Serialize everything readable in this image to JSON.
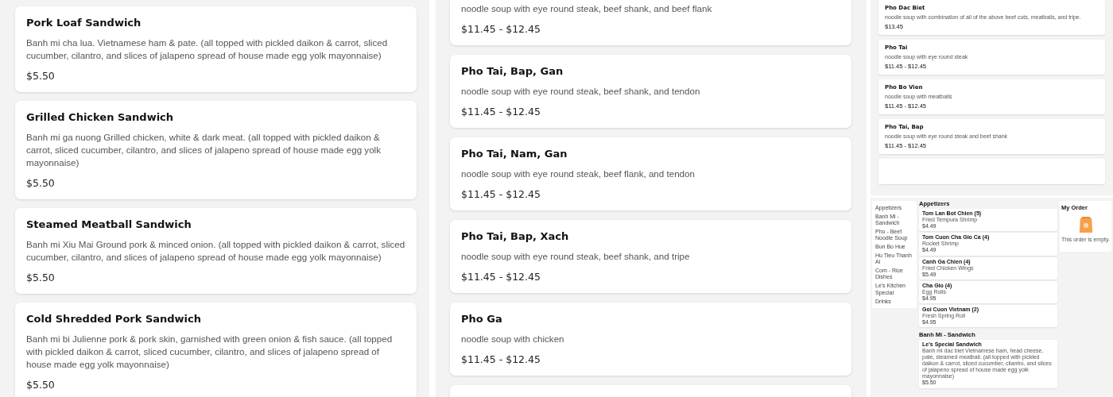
{
  "left_panel": {
    "items": [
      {
        "name": "Pork Loaf Sandwich",
        "description": "Banh mi cha lua. Vietnamese ham & pate. (all topped with pickled daikon & carrot, sliced cucumber, cilantro, and slices of jalapeno spread of house made egg yolk mayonnaise)",
        "price": "$5.50"
      },
      {
        "name": "Grilled Chicken Sandwich",
        "description": "Banh mi ga nuong Grilled chicken, white & dark meat. (all topped with pickled daikon & carrot, sliced cucumber, cilantro, and slices of jalapeno spread of house made egg yolk mayonnaise)",
        "price": "$5.50"
      },
      {
        "name": "Steamed Meatball Sandwich",
        "description": "Banh mi Xiu Mai Ground pork & minced onion. (all topped with pickled daikon & carrot, sliced cucumber, cilantro, and slices of jalapeno spread of house made egg yolk mayonnaise)",
        "price": "$5.50"
      },
      {
        "name": "Cold Shredded Pork Sandwich",
        "description": "Banh mi bi Julienne pork & pork skin, garnished with green onion & fish sauce. (all topped with pickled daikon & carrot, sliced cucumber, cilantro, and slices of jalapeno spread of house made egg yolk mayonnaise)",
        "price": "$5.50"
      }
    ]
  },
  "middle_panel": {
    "items": [
      {
        "description": "noodle soup with eye round steak, beef shank, and beef flank",
        "price": "$11.45 - $12.45"
      },
      {
        "name": "Pho Tai, Bap, Gan",
        "description": "noodle soup with eye round steak, beef shank, and tendon",
        "price": "$11.45 - $12.45"
      },
      {
        "name": "Pho Tai, Nam, Gan",
        "description": "noodle soup with eye round steak, beef flank, and tendon",
        "price": "$11.45 - $12.45"
      },
      {
        "name": "Pho Tai, Bap, Xach",
        "description": "noodle soup with eye round steak, beef shank, and tripe",
        "price": "$11.45 - $12.45"
      },
      {
        "name": "Pho Ga",
        "description": "noodle soup with chicken",
        "price": "$11.45 - $12.45"
      }
    ]
  },
  "right_top_panel": {
    "items": [
      {
        "name": "Pho Dac Biet",
        "description": "noodle soup with combination of all of the above beef cuts, meatballs, and tripe.",
        "price": "$13.45"
      },
      {
        "name": "Pho Tai",
        "description": "noodle soup with eye round steak",
        "price": "$11.45 - $12.45"
      },
      {
        "name": "Pho Bo Vien",
        "description": "noodle soup with meatballs",
        "price": "$11.45 - $12.45"
      },
      {
        "name": "Pho Tai, Bap",
        "description": "noodle soup with eye round steak and beef shank",
        "price": "$11.45 - $12.45"
      }
    ]
  },
  "mini_app": {
    "sidebar": [
      "Appetizers",
      "Banh Mi - Sandwich",
      "Pho - Beef Noodle Soup",
      "Bun Bo Hue",
      "Hu Tieu Thanh Ai",
      "Com - Rice Dishes",
      "Le's Kitchen Special",
      "Drinks"
    ],
    "sections": [
      {
        "title": "Appetizers",
        "items": [
          {
            "name": "Tom Lan Bot Chien (5)",
            "description": "Fried Tempura Shrimp",
            "price": "$4.49"
          },
          {
            "name": "Tom Cuon Cha Gio Ca (4)",
            "description": "Rocket Shrimp",
            "price": "$4.49"
          },
          {
            "name": "Canh Ga Chien (4)",
            "description": "Fried Chicken Wings",
            "price": "$5.49"
          },
          {
            "name": "Cha Gio (4)",
            "description": "Egg Rolls",
            "price": "$4.95"
          },
          {
            "name": "Goi Cuon Vietnam (2)",
            "description": "Fresh Spring Roll",
            "price": "$4.95"
          }
        ]
      },
      {
        "title": "Banh Mi - Sandwich",
        "items": [
          {
            "name": "Le's Special Sandwich",
            "description": "Banh mi dac biet Vietnamese ham, head cheese, pate, steamed meatball. (all topped with pickled daikon & carrot, sliced cucumber, cilantro, and slices of jalapeno spread of house made egg yolk mayonnaise)",
            "price": "$5.50"
          }
        ]
      }
    ],
    "order": {
      "title": "My Order",
      "empty_text": "This order is empty."
    }
  }
}
